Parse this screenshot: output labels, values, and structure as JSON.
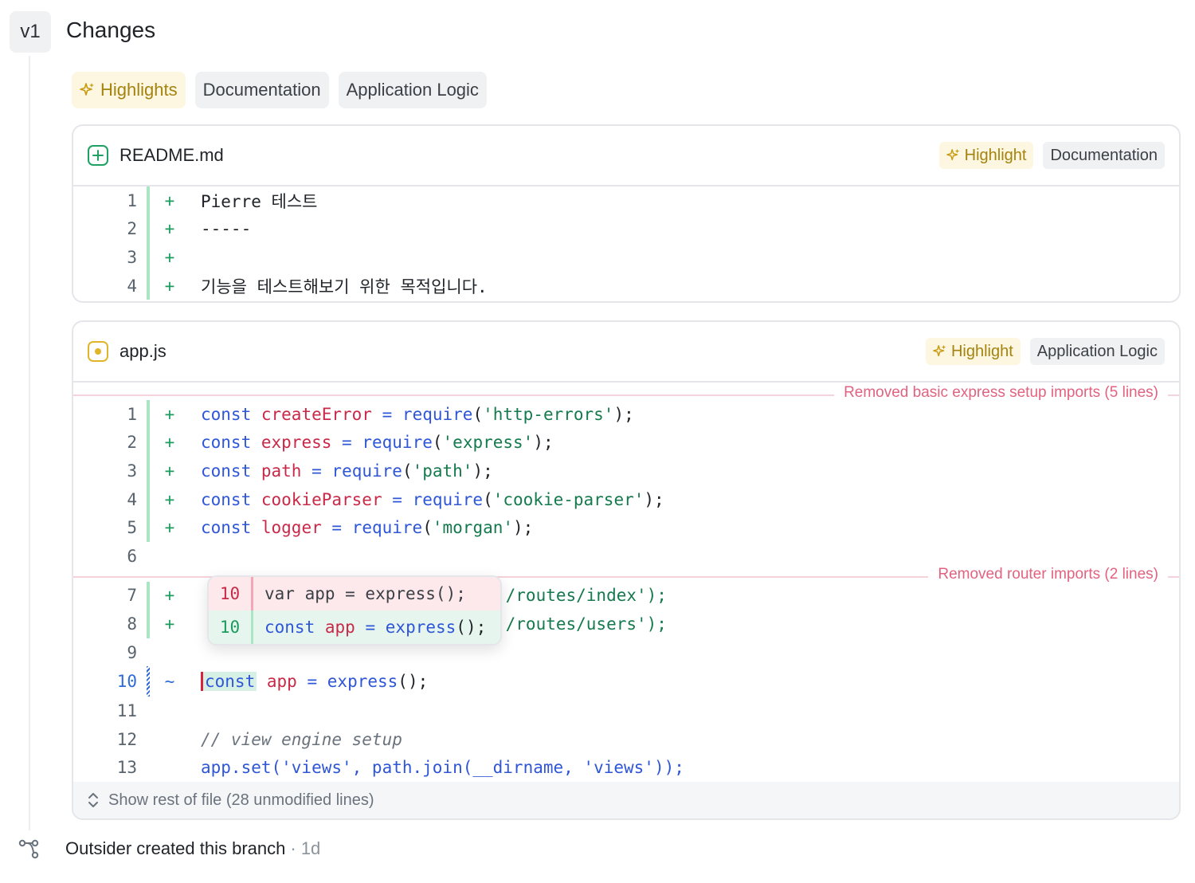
{
  "version": "v1",
  "section_title": "Changes",
  "filters": [
    {
      "label": "Highlights",
      "icon": "sparkle-icon"
    },
    {
      "label": "Documentation"
    },
    {
      "label": "Application Logic"
    }
  ],
  "files": [
    {
      "name": "README.md",
      "status": "added",
      "tags": [
        "Highlight",
        "Documentation"
      ],
      "lines": [
        {
          "n": "1",
          "sign": "+",
          "text": "Pierre 테스트"
        },
        {
          "n": "2",
          "sign": "+",
          "text": "-----"
        },
        {
          "n": "3",
          "sign": "+",
          "text": ""
        },
        {
          "n": "4",
          "sign": "+",
          "text": "기능을 테스트해보기 위한 목적입니다."
        }
      ]
    },
    {
      "name": "app.js",
      "status": "modified",
      "tags": [
        "Highlight",
        "Application Logic"
      ],
      "separators": [
        "Removed basic express setup imports (5 lines)",
        "Removed router imports (2 lines)"
      ],
      "lines": [
        {
          "n": "1",
          "sign": "+",
          "tokens": [
            "const",
            "createError",
            "=",
            "require",
            "(",
            "'http-errors'",
            ");"
          ]
        },
        {
          "n": "2",
          "sign": "+",
          "tokens": [
            "const",
            "express",
            "=",
            "require",
            "(",
            "'express'",
            ");"
          ]
        },
        {
          "n": "3",
          "sign": "+",
          "tokens": [
            "const",
            "path",
            "=",
            "require",
            "(",
            "'path'",
            ");"
          ]
        },
        {
          "n": "4",
          "sign": "+",
          "tokens": [
            "const",
            "cookieParser",
            "=",
            "require",
            "(",
            "'cookie-parser'",
            ");"
          ]
        },
        {
          "n": "5",
          "sign": "+",
          "tokens": [
            "const",
            "logger",
            "=",
            "require",
            "(",
            "'morgan'",
            ");"
          ]
        },
        {
          "n": "6",
          "sign": "",
          "text": ""
        },
        {
          "n": "7",
          "sign": "+",
          "text": "./routes/index');"
        },
        {
          "n": "8",
          "sign": "+",
          "text": "./routes/users');"
        },
        {
          "n": "9",
          "sign": "",
          "text": ""
        },
        {
          "n": "10",
          "sign": "~",
          "tokens": [
            "const",
            "app",
            "=",
            "express",
            "();"
          ]
        },
        {
          "n": "11",
          "sign": "",
          "text": ""
        },
        {
          "n": "12",
          "sign": "",
          "text": "// view engine setup"
        },
        {
          "n": "13",
          "sign": "",
          "text": "app.set('views', path.join(__dirname, 'views'));"
        }
      ],
      "popover": {
        "old": {
          "n": "10",
          "text": "var app = express();"
        },
        "new": {
          "n": "10",
          "tokens": [
            "const",
            "app",
            "=",
            "express",
            "();"
          ]
        }
      },
      "show_rest": "Show rest of file (28 unmodified lines)"
    }
  ],
  "event": {
    "text": "Outsider created this branch",
    "time": "· 1d"
  }
}
